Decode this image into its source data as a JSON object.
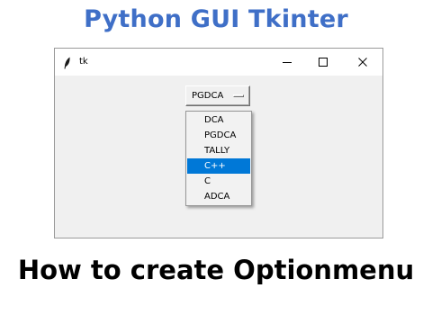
{
  "banner": {
    "title": "Python GUI Tkinter"
  },
  "window": {
    "title": "tk",
    "icon": "feather-icon",
    "controls": {
      "minimize_icon": "minimize-icon",
      "maximize_icon": "maximize-icon",
      "close_icon": "close-icon"
    }
  },
  "option_menu": {
    "selected_value": "PGDCA",
    "items": [
      "DCA",
      "PGDCA",
      "TALLY",
      "C++",
      "C",
      "ADCA"
    ],
    "highlighted_index": 3
  },
  "caption": {
    "text": "How to create Optionmenu"
  },
  "colors": {
    "banner_blue": "#3f6fc7",
    "highlight": "#0078d7",
    "window_bg": "#f0f0f0"
  }
}
